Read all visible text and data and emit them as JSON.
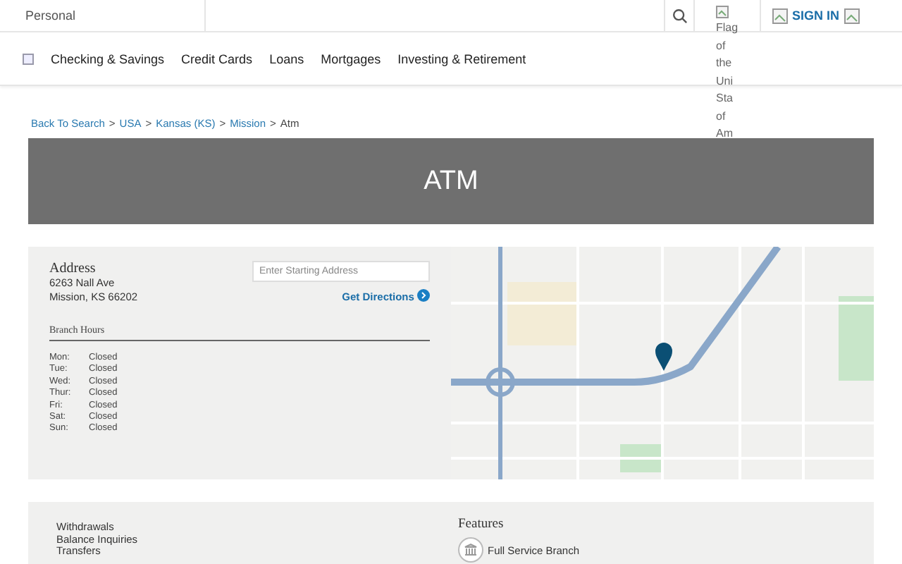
{
  "top_bar": {
    "segment": "Personal",
    "flag_alt": "Flag of the Uni Sta of Am",
    "sign_in": "SIGN IN"
  },
  "nav": {
    "items": [
      "Checking & Savings",
      "Credit Cards",
      "Loans",
      "Mortgages",
      "Investing & Retirement"
    ]
  },
  "breadcrumbs": [
    {
      "label": "Back To Search",
      "link": true
    },
    {
      "separator": ">",
      "label": "USA",
      "link": true
    },
    {
      "separator": ">",
      "label": "Kansas (KS)",
      "link": true
    },
    {
      "separator": ">",
      "label": "Mission",
      "link": true
    },
    {
      "separator": ">",
      "label": "Atm",
      "link": false
    }
  ],
  "banner": {
    "title": "ATM"
  },
  "location": {
    "address_heading": "Address",
    "address_lines": [
      "6263 Nall Ave",
      "Mission, KS 66202"
    ],
    "start_placeholder": "Enter Starting Address",
    "directions": "Get Directions",
    "hours_heading": "Branch Hours",
    "hours": [
      {
        "day": "Mon:",
        "time": "Closed"
      },
      {
        "day": "Tue:",
        "time": "Closed"
      },
      {
        "day": "Wed:",
        "time": "Closed"
      },
      {
        "day": "Thur:",
        "time": "Closed"
      },
      {
        "day": "Fri:",
        "time": "Closed"
      },
      {
        "day": "Sat:",
        "time": "Closed"
      },
      {
        "day": "Sun:",
        "time": "Closed"
      }
    ]
  },
  "services": {
    "items": [
      "Withdrawals",
      "Balance Inquiries",
      "Transfers"
    ],
    "features_heading": "Features",
    "features": [
      "Full Service Branch"
    ]
  }
}
